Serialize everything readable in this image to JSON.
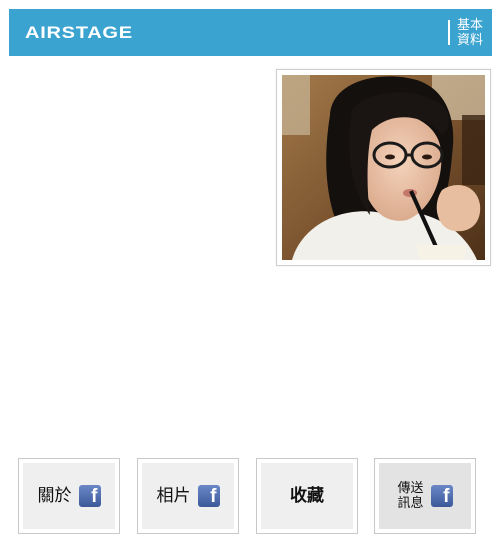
{
  "header": {
    "logo_text": "airstage",
    "profile_link": {
      "line1": "基本",
      "line2": "資料"
    }
  },
  "profile_photo": {
    "description": "profile-photo"
  },
  "nav_buttons": [
    {
      "label": "關於",
      "icon": "facebook-icon",
      "icon_text": "f"
    },
    {
      "label": "相片",
      "icon": "facebook-icon",
      "icon_text": "f"
    },
    {
      "label": "收藏"
    },
    {
      "line1": "傳送",
      "line2": "訊息",
      "icon": "facebook-icon",
      "icon_text": "f"
    }
  ],
  "colors": {
    "header_background": "#3ba3d0",
    "facebook_blue": "#3b5998",
    "button_background": "#efefef"
  }
}
